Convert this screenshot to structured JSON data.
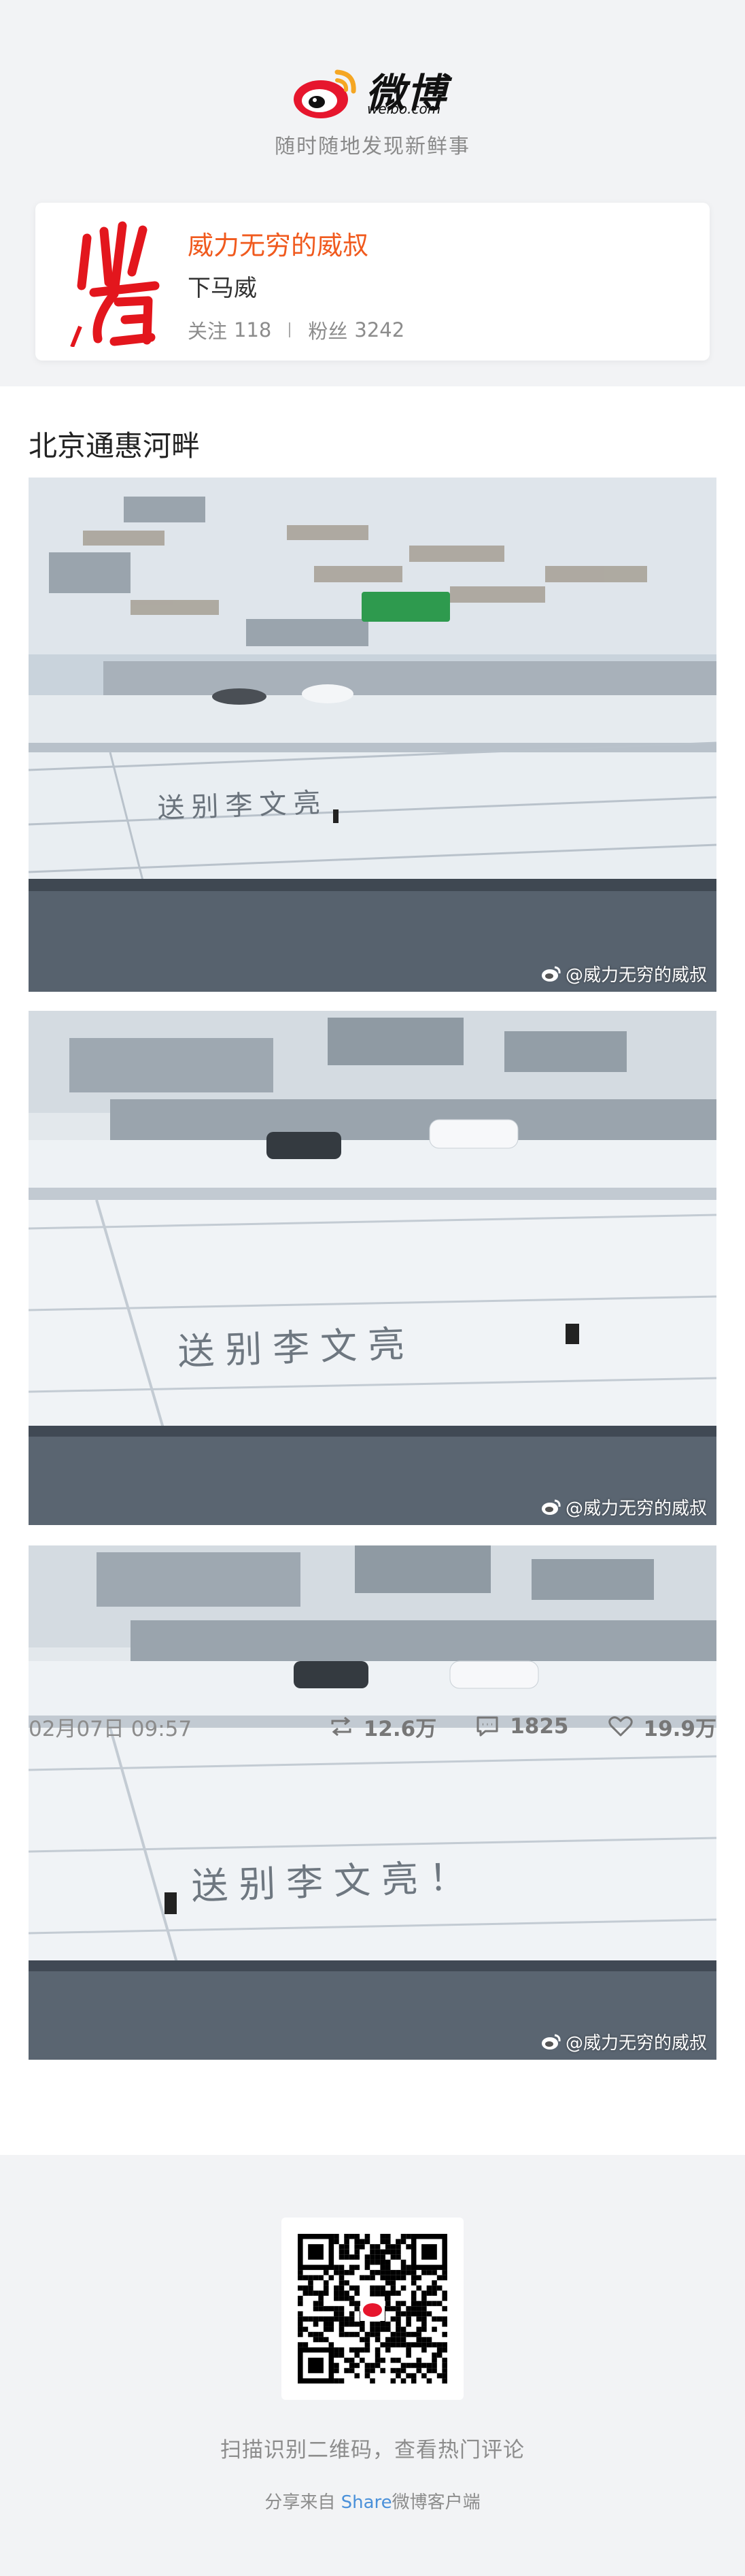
{
  "header": {
    "brand": "微博",
    "domain": "weibo.com",
    "slogan": "随时随地发现新鲜事"
  },
  "profile": {
    "username": "威力无穷的威叔",
    "bio": "下马威",
    "following_label": "关注",
    "following_count": "118",
    "followers_label": "粉丝",
    "followers_count": "3242",
    "avatar_icon": "red-calligraphy-avatar"
  },
  "post": {
    "text": "北京通惠河畔",
    "images": [
      {
        "snow_text": "送别李文亮",
        "watermark": "@威力无穷的威叔"
      },
      {
        "snow_text": "送别李文亮",
        "watermark": "@威力无穷的威叔"
      },
      {
        "snow_text": "送别李文亮！",
        "watermark": "@威力无穷的威叔"
      }
    ],
    "date": "02月07日 09:57",
    "reposts": "12.6万",
    "comments": "1825",
    "likes": "19.9万",
    "repost_icon": "repost-icon",
    "comment_icon": "comment-icon",
    "like_icon": "heart-icon"
  },
  "footer": {
    "scan_hint": "扫描识别二维码，查看热门评论",
    "share_prefix": "分享来自 ",
    "share_highlight": "Share",
    "share_suffix": "微博客户端"
  },
  "colors": {
    "accent": "#f05a1e",
    "page_bg": "#f2f3f5",
    "muted_text": "#8c8c8c",
    "link_blue": "#4a90d9"
  }
}
